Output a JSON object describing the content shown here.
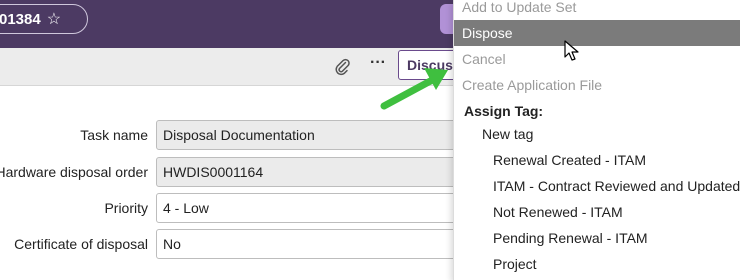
{
  "header": {
    "record_number": "01384",
    "star_icon": "star-outline-icon"
  },
  "toolbar": {
    "attachment_icon": "paperclip-icon",
    "more_icon": "more-horizontal-icon",
    "more_label": "···",
    "discuss_label": "Discuss"
  },
  "form": {
    "fields": [
      {
        "label": "Task name",
        "value": "Disposal Documentation",
        "readonly": true
      },
      {
        "label": "Hardware disposal order",
        "value": "HWDIS0001164",
        "readonly": true
      },
      {
        "label": "Priority",
        "value": "4 - Low",
        "readonly": false
      },
      {
        "label": "Certificate of disposal",
        "value": "No",
        "readonly": false
      }
    ]
  },
  "context_menu": {
    "items": [
      {
        "label": "Add to Update Set",
        "state": "disabled"
      },
      {
        "label": "Dispose",
        "state": "hovered"
      },
      {
        "label": "Cancel",
        "state": "disabled"
      },
      {
        "label": "Create Application File",
        "state": "disabled"
      }
    ],
    "assign_tag_heading": "Assign Tag:",
    "new_tag_label": "New tag",
    "tags": [
      "Renewal Created - ITAM",
      "ITAM - Contract Reviewed and Updated",
      "Not Renewed - ITAM",
      "Pending Renewal - ITAM",
      "Project"
    ]
  },
  "colors": {
    "header_bg": "#4c3a63",
    "accent_purple": "#6a4a8c",
    "menu_hover_bg": "#7b7b7b",
    "arrow_green": "#3fbf3f"
  }
}
